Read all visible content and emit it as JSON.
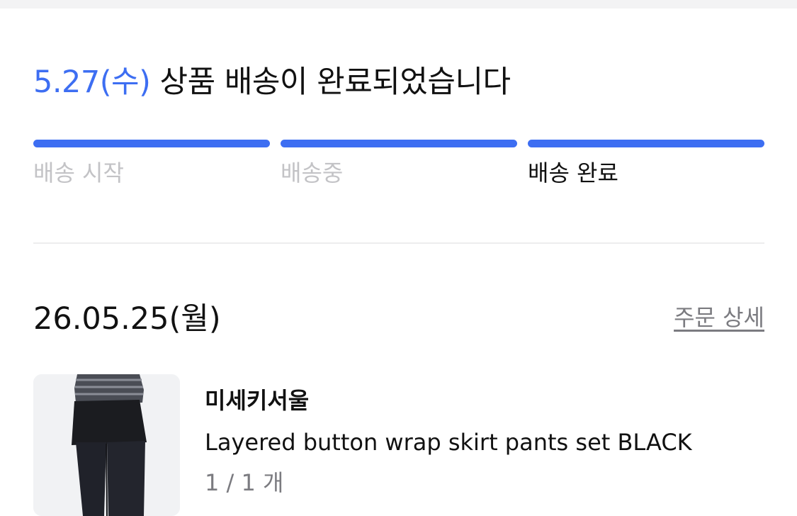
{
  "delivery_status": {
    "date": "5.27(수)",
    "message": " 상품 배송이 완료되었습니다"
  },
  "progress": {
    "steps": [
      {
        "label": "배송 시작",
        "active": false
      },
      {
        "label": "배송중",
        "active": false
      },
      {
        "label": "배송 완료",
        "active": true
      }
    ]
  },
  "order": {
    "date": "26.05.25(월)",
    "detail_link": "주문 상세",
    "item": {
      "brand": "미세키서울",
      "name": "Layered button wrap skirt pants set BLACK",
      "quantity": "1 / 1 개"
    }
  },
  "colors": {
    "accent": "#3d6ef2",
    "inactive_text": "#c3c3c6",
    "secondary_text": "#7b7b80"
  }
}
